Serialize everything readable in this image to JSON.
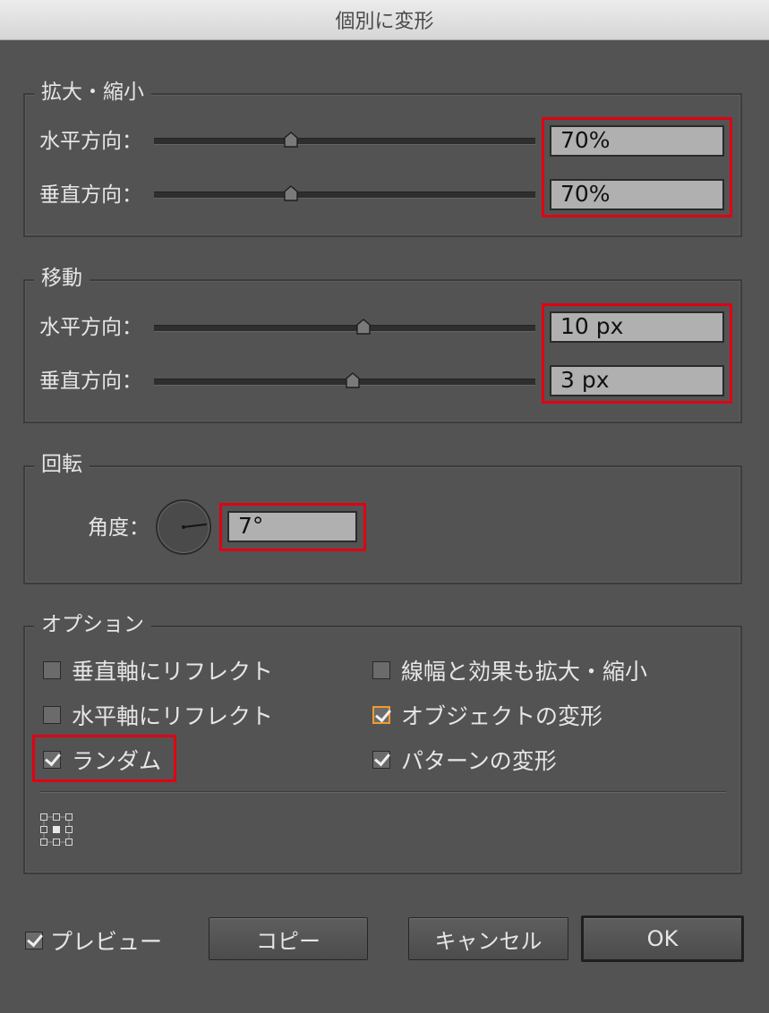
{
  "window": {
    "title": "個別に変形"
  },
  "scale": {
    "legend": "拡大・縮小",
    "horizontal": {
      "label": "水平方向：",
      "value": "70%",
      "slider_fraction": 0.36
    },
    "vertical": {
      "label": "垂直方向：",
      "value": "70%",
      "slider_fraction": 0.36
    }
  },
  "move": {
    "legend": "移動",
    "horizontal": {
      "label": "水平方向：",
      "value": "10 px",
      "slider_fraction": 0.55
    },
    "vertical": {
      "label": "垂直方向：",
      "value": "3 px",
      "slider_fraction": 0.52
    }
  },
  "rotate": {
    "legend": "回転",
    "angle_label": "角度：",
    "angle_value": "7°",
    "angle_degrees": 7
  },
  "options": {
    "legend": "オプション",
    "reflect_vertical": {
      "label": "垂直軸にリフレクト",
      "checked": false
    },
    "reflect_horizontal": {
      "label": "水平軸にリフレクト",
      "checked": false
    },
    "random": {
      "label": "ランダム",
      "checked": true
    },
    "scale_strokes": {
      "label": "線幅と効果も拡大・縮小",
      "checked": false
    },
    "transform_objects": {
      "label": "オブジェクトの変形",
      "checked": true
    },
    "transform_patterns": {
      "label": "パターンの変形",
      "checked": true
    }
  },
  "footer": {
    "preview": {
      "label": "プレビュー",
      "checked": true
    },
    "copy_button": "コピー",
    "cancel_button": "キャンセル",
    "ok_button": "OK"
  },
  "colors": {
    "highlight": "#e00012",
    "focus": "#f29a29",
    "background": "#535353"
  },
  "icons": [
    "reference-point-icon",
    "checkbox-check-icon",
    "slider-thumb-icon",
    "angle-dial-icon"
  ]
}
